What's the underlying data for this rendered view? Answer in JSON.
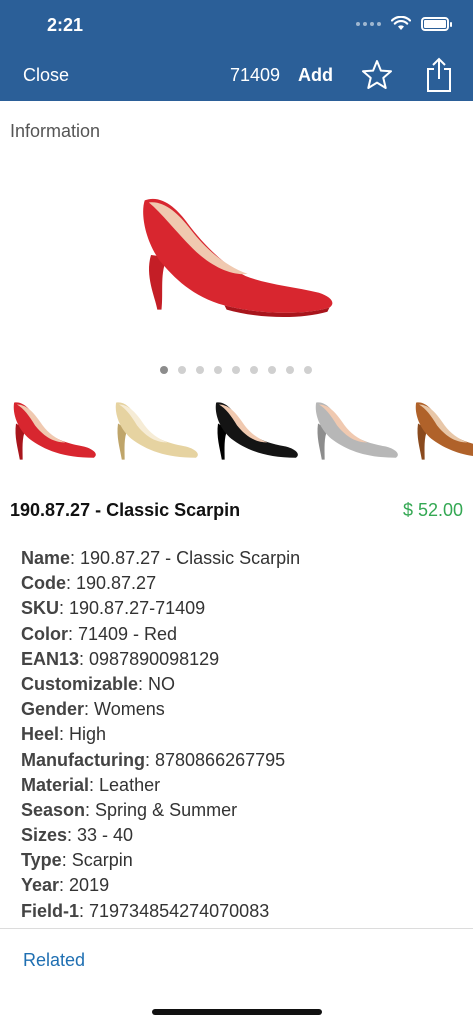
{
  "status_bar": {
    "time": "2:21"
  },
  "nav": {
    "close_label": "Close",
    "item_number": "71409",
    "add_label": "Add",
    "star_icon": "star-outline-icon",
    "share_icon": "share-icon"
  },
  "section_title": "Information",
  "gallery": {
    "page_count": 9,
    "active_index": 0,
    "thumbnails": [
      {
        "color_name": "red",
        "body": "#d8262f"
      },
      {
        "color_name": "gold",
        "body": "#e6d3a1"
      },
      {
        "color_name": "black",
        "body": "#141414"
      },
      {
        "color_name": "silver",
        "body": "#b7b7b7"
      },
      {
        "color_name": "cognac",
        "body": "#b0622a"
      }
    ]
  },
  "product": {
    "title": "190.87.27 - Classic Scarpin",
    "price": "$ 52.00",
    "attributes": [
      {
        "key": "Name",
        "value": ": 190.87.27 - Classic Scarpin"
      },
      {
        "key": "Code",
        "value": ": 190.87.27"
      },
      {
        "key": "SKU",
        "value": ": 190.87.27-71409"
      },
      {
        "key": "Color",
        "value": ": 71409 - Red"
      },
      {
        "key": "EAN13",
        "value": ": 0987890098129"
      },
      {
        "key": "Customizable",
        "value": ": NO"
      },
      {
        "key": "Gender",
        "value": ": Womens"
      },
      {
        "key": "Heel",
        "value": ": High"
      },
      {
        "key": "Manufacturing",
        "value": ": 8780866267795"
      },
      {
        "key": "Material",
        "value": ": Leather"
      },
      {
        "key": "Season",
        "value": ": Spring & Summer"
      },
      {
        "key": "Sizes",
        "value": ": 33 - 40"
      },
      {
        "key": "Type",
        "value": ": Scarpin"
      },
      {
        "key": "Year",
        "value": ": 2019"
      },
      {
        "key": "Field-1",
        "value": ": 719734854274070083"
      }
    ]
  },
  "related_label": "Related",
  "colors": {
    "nav_background": "#2b5f98",
    "price": "#34a853",
    "link": "#1f6fb2",
    "shoe_red": "#d8262f"
  }
}
